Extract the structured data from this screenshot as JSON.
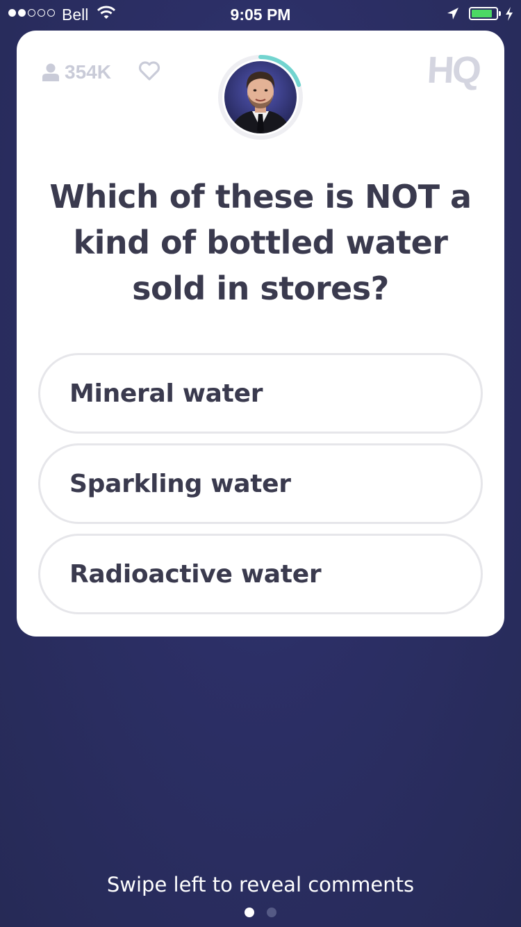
{
  "status_bar": {
    "signal_bars_filled": 2,
    "signal_bars_total": 5,
    "carrier": "Bell",
    "time": "9:05 PM",
    "battery_level": 0.85,
    "battery_color": "#4cd964",
    "icons": [
      "wifi-icon",
      "location-arrow-icon",
      "battery-icon",
      "charging-bolt-icon"
    ]
  },
  "card": {
    "viewer_count": "354K",
    "logo": "HQ",
    "timer_progress": 0.2,
    "timer_color": "#72d4cf",
    "question": "Which of these is NOT a kind of bottled water sold in stores?",
    "answers": [
      {
        "label": "Mineral water"
      },
      {
        "label": "Sparkling water"
      },
      {
        "label": "Radioactive water"
      }
    ]
  },
  "footer": {
    "hint": "Swipe left to reveal comments",
    "page_count": 2,
    "active_page": 1
  },
  "colors": {
    "background": "#2c2f66",
    "card": "#ffffff",
    "text": "#3a3a4e",
    "answer_border": "#e6e6ea",
    "muted": "#c9cbd8"
  }
}
